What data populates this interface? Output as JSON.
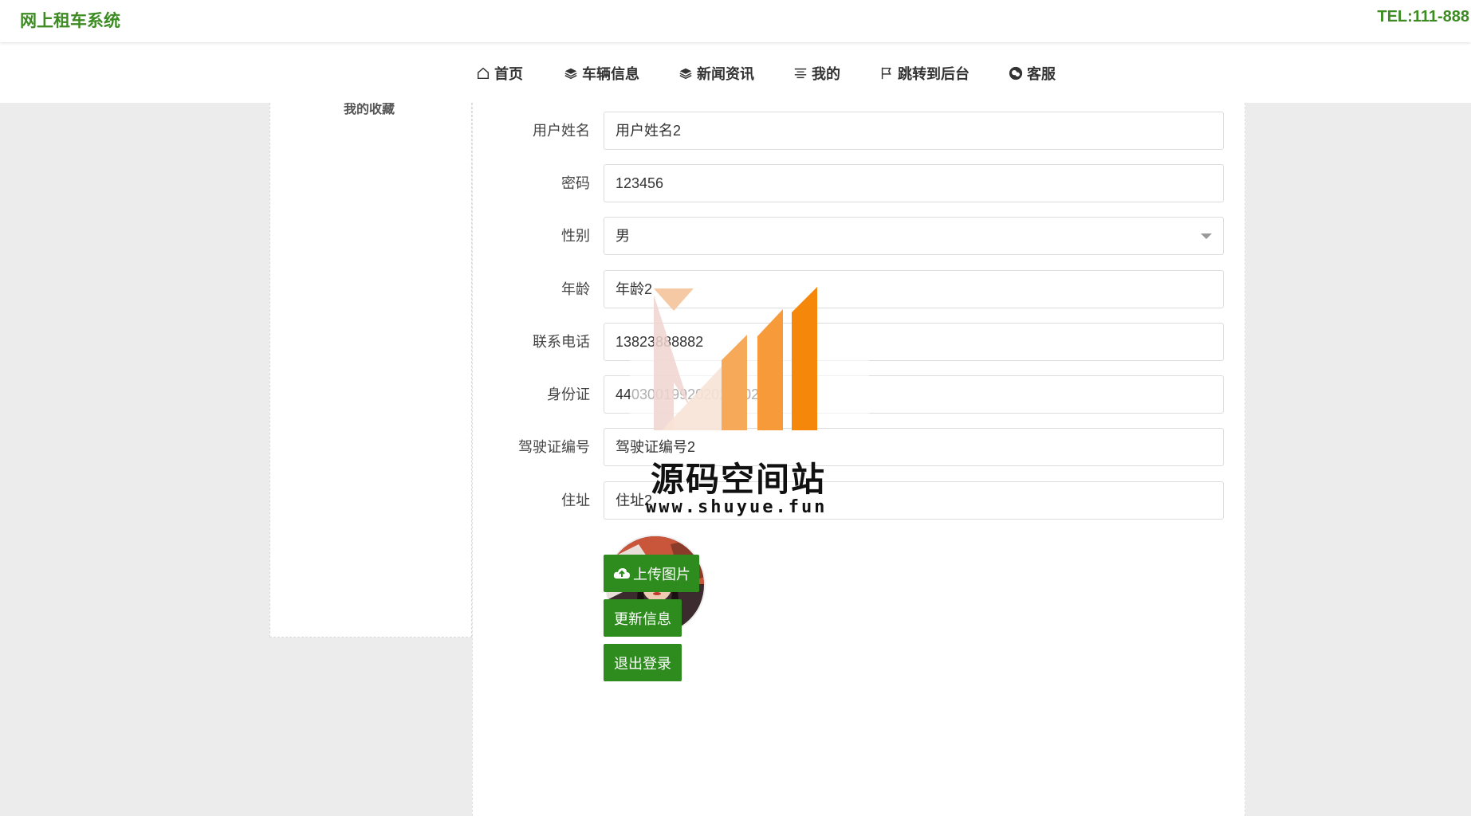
{
  "header": {
    "brand": "网上租车系统",
    "tel": "TEL:111-888"
  },
  "nav": [
    {
      "label": "首页",
      "icon": "home-icon"
    },
    {
      "label": "车辆信息",
      "icon": "layers-icon"
    },
    {
      "label": "新闻资讯",
      "icon": "layers-icon"
    },
    {
      "label": "我的",
      "icon": "list-icon"
    },
    {
      "label": "跳转到后台",
      "icon": "flag-icon"
    },
    {
      "label": "客服",
      "icon": "wechat-icon"
    }
  ],
  "sidebar": {
    "favorites_label": "我的收藏"
  },
  "form": {
    "fields": [
      {
        "label": "用户姓名",
        "value": "用户姓名2"
      },
      {
        "label": "密码",
        "value": "123456"
      },
      {
        "label": "性别",
        "value": "男"
      },
      {
        "label": "年龄",
        "value": "年龄2"
      },
      {
        "label": "联系电话",
        "value": "13823888882"
      },
      {
        "label": "身份证",
        "value": "440300199202020002"
      },
      {
        "label": "驾驶证编号",
        "value": "驾驶证编号2"
      },
      {
        "label": "住址",
        "value": "住址2"
      }
    ],
    "upload_label": "上传图片",
    "update_label": "更新信息",
    "logout_label": "退出登录"
  },
  "watermark": {
    "name": "源码空间站",
    "url": "www.shuyue.fun"
  },
  "colors": {
    "brand_green": "#3d8c23",
    "button_green": "#2e8b1e",
    "watermark_orange": "#f5870a"
  }
}
